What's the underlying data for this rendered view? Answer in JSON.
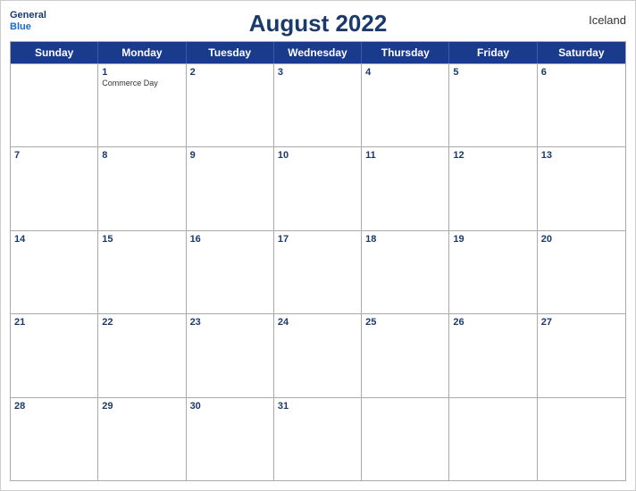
{
  "header": {
    "title": "August 2022",
    "country": "Iceland",
    "logo_line1": "General",
    "logo_line2": "Blue"
  },
  "weekdays": [
    "Sunday",
    "Monday",
    "Tuesday",
    "Wednesday",
    "Thursday",
    "Friday",
    "Saturday"
  ],
  "weeks": [
    [
      {
        "day": "",
        "empty": true
      },
      {
        "day": "1",
        "holiday": "Commerce Day"
      },
      {
        "day": "2",
        "holiday": ""
      },
      {
        "day": "3",
        "holiday": ""
      },
      {
        "day": "4",
        "holiday": ""
      },
      {
        "day": "5",
        "holiday": ""
      },
      {
        "day": "6",
        "holiday": ""
      }
    ],
    [
      {
        "day": "7",
        "holiday": ""
      },
      {
        "day": "8",
        "holiday": ""
      },
      {
        "day": "9",
        "holiday": ""
      },
      {
        "day": "10",
        "holiday": ""
      },
      {
        "day": "11",
        "holiday": ""
      },
      {
        "day": "12",
        "holiday": ""
      },
      {
        "day": "13",
        "holiday": ""
      }
    ],
    [
      {
        "day": "14",
        "holiday": ""
      },
      {
        "day": "15",
        "holiday": ""
      },
      {
        "day": "16",
        "holiday": ""
      },
      {
        "day": "17",
        "holiday": ""
      },
      {
        "day": "18",
        "holiday": ""
      },
      {
        "day": "19",
        "holiday": ""
      },
      {
        "day": "20",
        "holiday": ""
      }
    ],
    [
      {
        "day": "21",
        "holiday": ""
      },
      {
        "day": "22",
        "holiday": ""
      },
      {
        "day": "23",
        "holiday": ""
      },
      {
        "day": "24",
        "holiday": ""
      },
      {
        "day": "25",
        "holiday": ""
      },
      {
        "day": "26",
        "holiday": ""
      },
      {
        "day": "27",
        "holiday": ""
      }
    ],
    [
      {
        "day": "28",
        "holiday": ""
      },
      {
        "day": "29",
        "holiday": ""
      },
      {
        "day": "30",
        "holiday": ""
      },
      {
        "day": "31",
        "holiday": ""
      },
      {
        "day": "",
        "empty": true
      },
      {
        "day": "",
        "empty": true
      },
      {
        "day": "",
        "empty": true
      }
    ]
  ]
}
